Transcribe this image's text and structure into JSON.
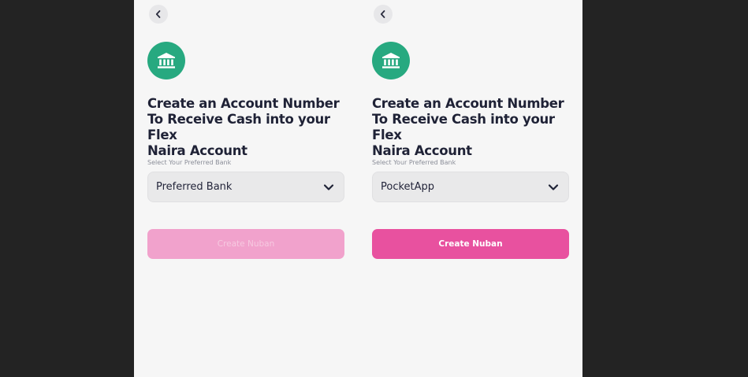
{
  "screens": [
    {
      "title_lines": [
        "Create an Account Number",
        "To Receive Cash into your Flex",
        "Naira Account"
      ],
      "field_label": "Select Your Preferred Bank",
      "selected_bank": "Preferred Bank",
      "button_label": "Create Nuban",
      "button_state": "disabled"
    },
    {
      "title_lines": [
        "Create an Account Number",
        "To Receive Cash into your Flex",
        "Naira Account"
      ],
      "field_label": "Select Your Preferred Bank",
      "selected_bank": "PocketApp",
      "button_label": "Create Nuban",
      "button_state": "enabled"
    }
  ],
  "colors": {
    "backdrop": "#232323",
    "screen_bg": "#f6f6f6",
    "accent_green": "#27a980",
    "cta_pink": "#e8519f",
    "cta_pink_disabled": "#f1a2cc",
    "text_dark": "#1f2236"
  },
  "icons": {
    "back": "chevron-left-icon",
    "bank": "bank-icon",
    "dropdown": "chevron-down-icon"
  }
}
